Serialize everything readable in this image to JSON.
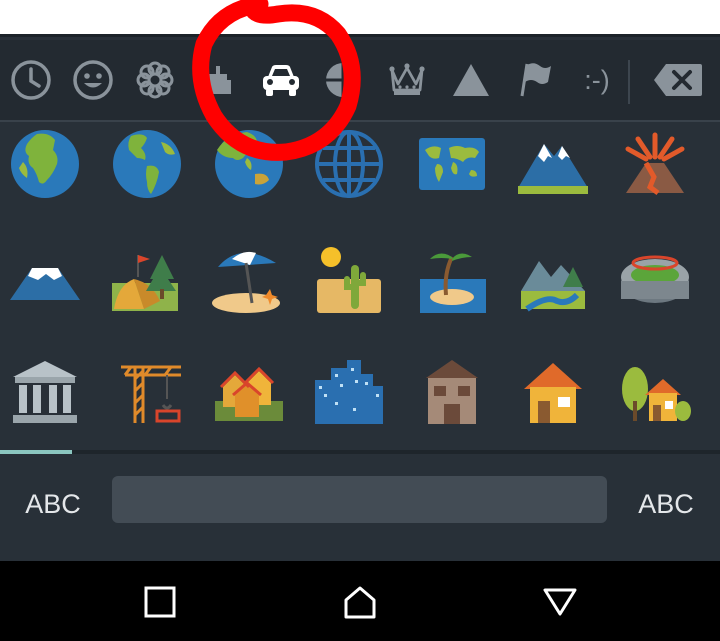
{
  "categories": [
    {
      "name": "recents",
      "icon": "clock-icon",
      "active": false
    },
    {
      "name": "smileys",
      "icon": "smiley-icon",
      "active": false
    },
    {
      "name": "nature",
      "icon": "flower-icon",
      "active": false
    },
    {
      "name": "food",
      "icon": "cake-icon",
      "active": false
    },
    {
      "name": "travel",
      "icon": "car-icon",
      "active": true
    },
    {
      "name": "activities",
      "icon": "ball-icon",
      "active": false
    },
    {
      "name": "objects",
      "icon": "crown-icon",
      "active": false
    },
    {
      "name": "symbols",
      "icon": "triangle-icon",
      "active": false
    },
    {
      "name": "flags",
      "icon": "flag-icon",
      "active": false
    },
    {
      "name": "emoticons",
      "icon": "emoticon-text-icon",
      "label": ":-)",
      "active": false
    }
  ],
  "backspace": {
    "icon": "backspace-icon"
  },
  "emoji_rows": [
    [
      "globe-europe-africa",
      "globe-americas",
      "globe-asia-australia",
      "globe-meridians",
      "world-map",
      "snow-mountain",
      "volcano"
    ],
    [
      "mount-fuji",
      "camping",
      "beach-umbrella",
      "desert",
      "desert-island",
      "national-park",
      "stadium"
    ],
    [
      "classical-building",
      "construction-crane",
      "houses",
      "cityscape",
      "derelict-house",
      "house",
      "house-with-garden"
    ]
  ],
  "bottom": {
    "left_label": "ABC",
    "right_label": "ABC"
  },
  "navbar": {
    "recents": "recents-square-icon",
    "home": "home-icon",
    "back": "back-triangle-icon"
  },
  "annotation": {
    "color": "#ff0000"
  },
  "colors": {
    "keyboard_bg": "#283038",
    "category_bar": "#232a31",
    "icon_gray": "#8a939b",
    "active_icon": "#ffffff",
    "indicator": "#8bc6c0",
    "space_key": "#434c55"
  }
}
